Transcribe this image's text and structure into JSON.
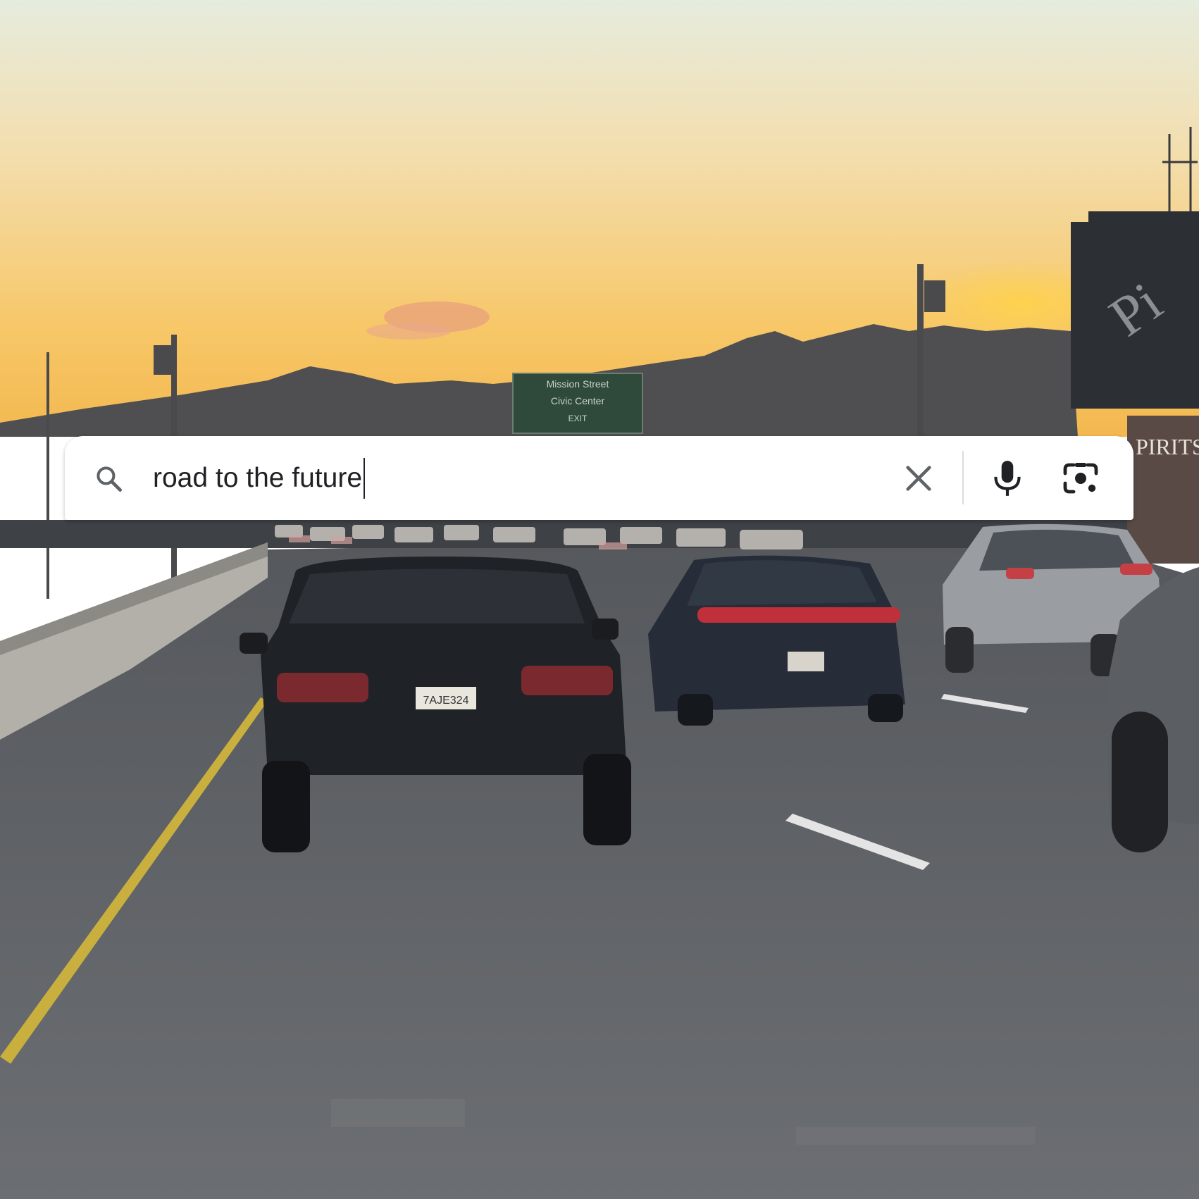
{
  "search": {
    "query": "road to the future",
    "clear_icon": "close-icon",
    "voice_icon": "microphone-icon",
    "lens_icon": "camera-lens-icon",
    "search_icon": "search-icon"
  },
  "signs": {
    "overhead": [
      "Mission Street",
      "Civic Center",
      "EXIT"
    ],
    "building": "PIRITS",
    "billboard": "Pi"
  },
  "plate": "7AJE324",
  "colors": {
    "sky_top": "#e9ecdc",
    "sky_bottom": "#f6c15a",
    "road": "#5f6266",
    "search_bg": "#ffffff",
    "text": "#202124",
    "icon": "#5f6368"
  }
}
